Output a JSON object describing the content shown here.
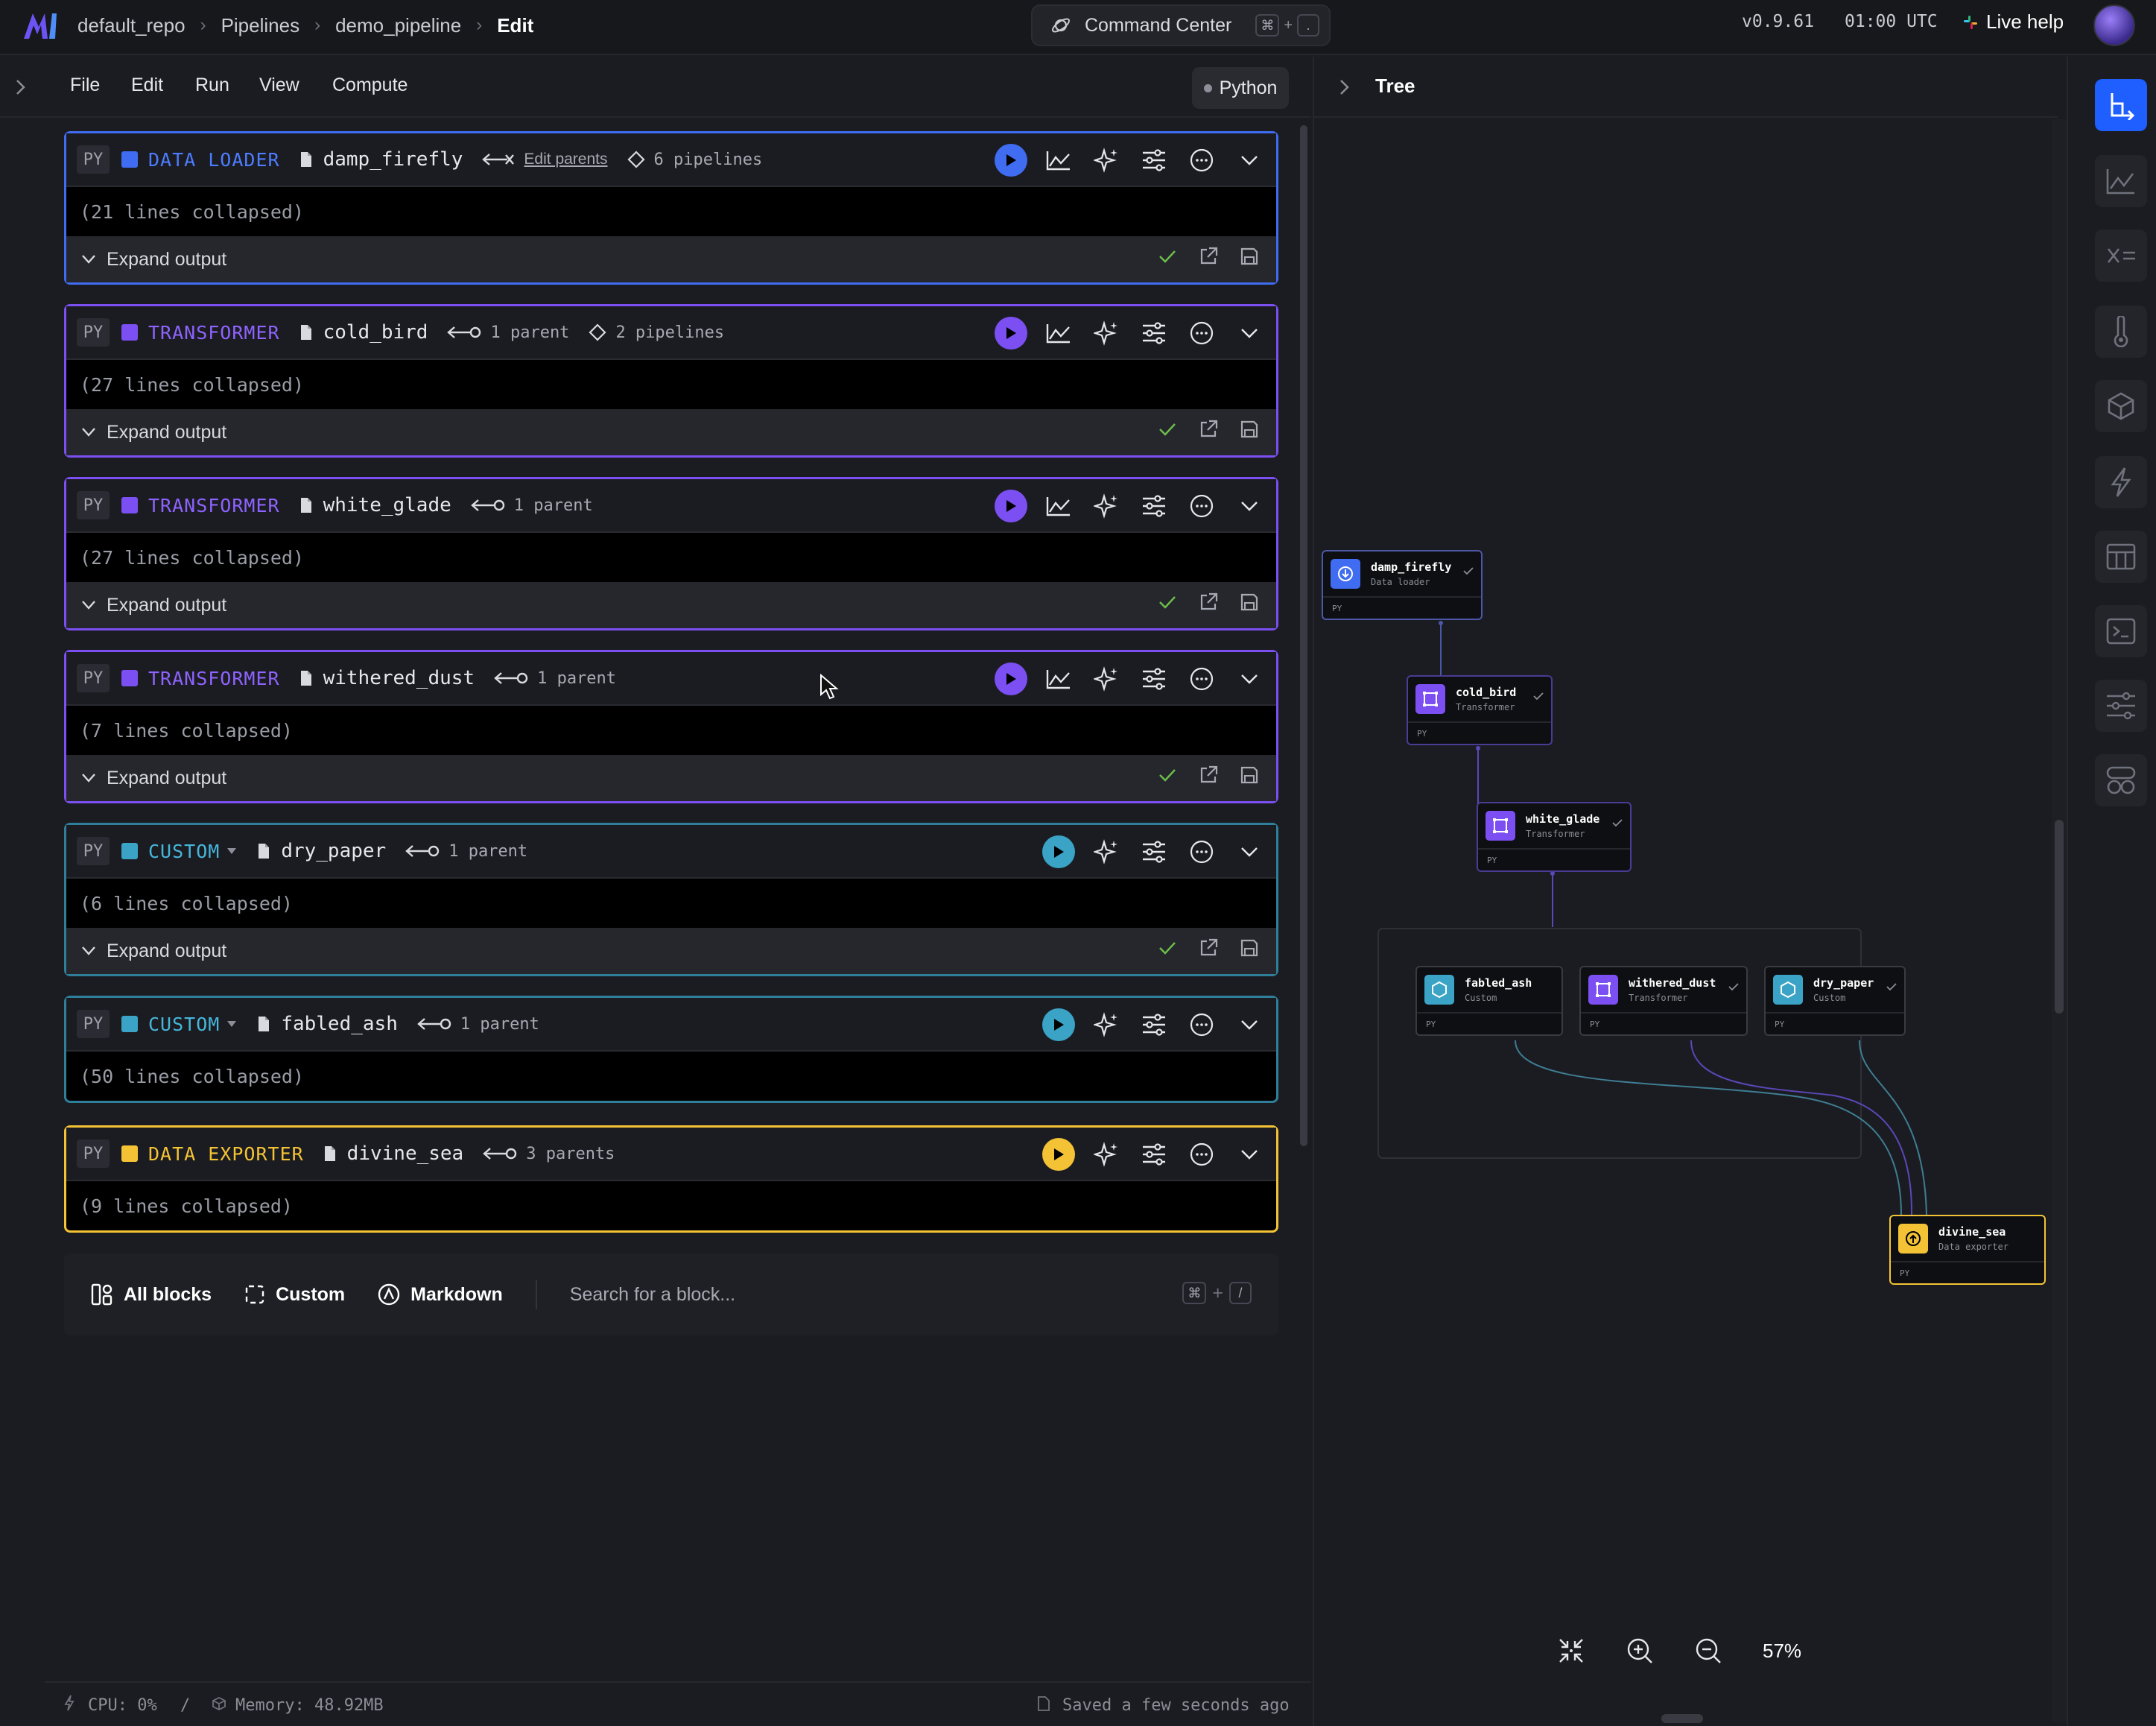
{
  "topbar": {
    "breadcrumbs": [
      "default_repo",
      "Pipelines",
      "demo_pipeline",
      "Edit"
    ],
    "command_center": {
      "label": "Command Center",
      "keys": [
        "⌘",
        "+",
        "."
      ]
    },
    "version": "v0.9.61",
    "time": "01:00 UTC",
    "live_help": "Live help"
  },
  "menubar": {
    "items": [
      "File",
      "Edit",
      "Run",
      "View",
      "Compute"
    ],
    "language": "Python"
  },
  "blocks": [
    {
      "lang": "PY",
      "type": "DATA LOADER",
      "color": "#3f6cf0",
      "name": "damp_firefly",
      "parents_label": "Edit parents",
      "pipelines": "6 pipelines",
      "body": "(21 lines collapsed)",
      "footer": "Expand output"
    },
    {
      "lang": "PY",
      "type": "TRANSFORMER",
      "color": "#7b4ff2",
      "name": "cold_bird",
      "parents": "1 parent",
      "pipelines": "2 pipelines",
      "body": "(27 lines collapsed)",
      "footer": "Expand output"
    },
    {
      "lang": "PY",
      "type": "TRANSFORMER",
      "color": "#7b4ff2",
      "name": "white_glade",
      "parents": "1 parent",
      "body": "(27 lines collapsed)",
      "footer": "Expand output"
    },
    {
      "lang": "PY",
      "type": "TRANSFORMER",
      "color": "#7b4ff2",
      "name": "withered_dust",
      "parents": "1 parent",
      "body": "(7 lines collapsed)",
      "footer": "Expand output"
    },
    {
      "lang": "PY",
      "type": "CUSTOM",
      "color": "#3aa3c6",
      "name": "dry_paper",
      "parents": "1 parent",
      "body": "(6 lines collapsed)",
      "footer": "Expand output"
    },
    {
      "lang": "PY",
      "type": "CUSTOM",
      "color": "#3aa3c6",
      "name": "fabled_ash",
      "parents": "1 parent",
      "body": "(50 lines collapsed)"
    },
    {
      "lang": "PY",
      "type": "DATA EXPORTER",
      "color": "#f4c335",
      "name": "divine_sea",
      "parents": "3 parents",
      "body": "(9 lines collapsed)"
    }
  ],
  "add_block_bar": {
    "all_blocks": "All blocks",
    "custom": "Custom",
    "markdown": "Markdown",
    "search_placeholder": "Search for a block...",
    "keys": [
      "⌘",
      "+",
      "/"
    ]
  },
  "status": {
    "cpu": "CPU: 0%",
    "separator": "/",
    "memory": "Memory: 48.92MB",
    "saved": "Saved a few seconds ago"
  },
  "tree": {
    "title": "Tree",
    "nodes": [
      {
        "name": "damp_firefly",
        "type": "Data loader",
        "lang": "PY"
      },
      {
        "name": "cold_bird",
        "type": "Transformer",
        "lang": "PY"
      },
      {
        "name": "white_glade",
        "type": "Transformer",
        "lang": "PY"
      },
      {
        "name": "fabled_ash",
        "type": "Custom",
        "lang": "PY"
      },
      {
        "name": "withered_dust",
        "type": "Transformer",
        "lang": "PY"
      },
      {
        "name": "dry_paper",
        "type": "Custom",
        "lang": "PY"
      },
      {
        "name": "divine_sea",
        "type": "Data exporter",
        "lang": "PY"
      }
    ],
    "zoom": "57%"
  },
  "right_rail": [
    "tree-icon",
    "chart-icon",
    "variables-icon",
    "thermometer-icon",
    "cube-icon",
    "lightning-icon",
    "table-icon",
    "terminal-icon",
    "settings-icon",
    "blocks-icon"
  ]
}
